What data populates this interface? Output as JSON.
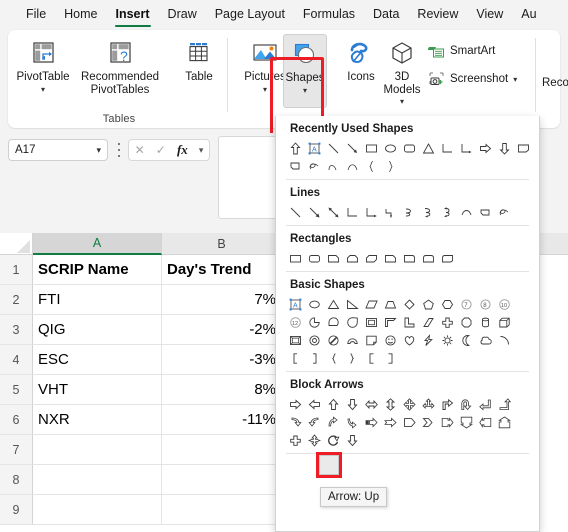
{
  "ribbon_tabs": [
    {
      "label": "File",
      "active": false
    },
    {
      "label": "Home",
      "active": false
    },
    {
      "label": "Insert",
      "active": true
    },
    {
      "label": "Draw",
      "active": false
    },
    {
      "label": "Page Layout",
      "active": false
    },
    {
      "label": "Formulas",
      "active": false
    },
    {
      "label": "Data",
      "active": false
    },
    {
      "label": "Review",
      "active": false
    },
    {
      "label": "View",
      "active": false
    },
    {
      "label": "Au",
      "active": false
    }
  ],
  "ribbon": {
    "tables_group_label": "Tables",
    "pivot_table_label": "PivotTable",
    "recommended_pivot_label_line1": "Recommended",
    "recommended_pivot_label_line2": "PivotTables",
    "table_label": "Table",
    "pictures_label": "Pictures",
    "shapes_label": "Shapes",
    "icons_label": "Icons",
    "models_label_line1": "3D",
    "models_label_line2": "Models",
    "smartart_label": "SmartArt",
    "screenshot_label": "Screenshot",
    "reco_label": "Reco",
    "highlight_color": "#ee1c25",
    "accent_color": "#107c41"
  },
  "formula_bar": {
    "name_box_value": "A17",
    "cancel_icon": "cross-icon",
    "confirm_icon": "check-icon",
    "fx_label": "fx",
    "formula_value": ""
  },
  "grid": {
    "columns": [
      "A",
      "B"
    ],
    "selected_column": "A",
    "rows": [
      "1",
      "2",
      "3",
      "4",
      "5",
      "6",
      "7",
      "8",
      "9"
    ],
    "data": [
      {
        "a": "SCRIP Name",
        "b": "Day's Trend",
        "header": true
      },
      {
        "a": "FTI",
        "b": "7%",
        "header": false
      },
      {
        "a": "QIG",
        "b": "-2%",
        "header": false
      },
      {
        "a": "ESC",
        "b": "-3%",
        "header": false
      },
      {
        "a": "VHT",
        "b": "8%",
        "header": false
      },
      {
        "a": "NXR",
        "b": "-11%",
        "header": false
      },
      {
        "a": "",
        "b": "",
        "header": false
      },
      {
        "a": "",
        "b": "",
        "header": false
      },
      {
        "a": "",
        "b": "",
        "header": false
      }
    ]
  },
  "shapes_dropdown": {
    "sections": [
      {
        "title": "Recently Used Shapes",
        "counts": [
          13,
          7
        ]
      },
      {
        "title": "Lines",
        "counts": [
          12
        ]
      },
      {
        "title": "Rectangles",
        "counts": [
          9
        ]
      },
      {
        "title": "Basic Shapes",
        "counts": [
          12,
          12,
          12,
          6
        ]
      },
      {
        "title": "Block Arrows",
        "counts": [
          12,
          12,
          4
        ]
      }
    ]
  },
  "tooltip": {
    "text": "Arrow: Up"
  }
}
